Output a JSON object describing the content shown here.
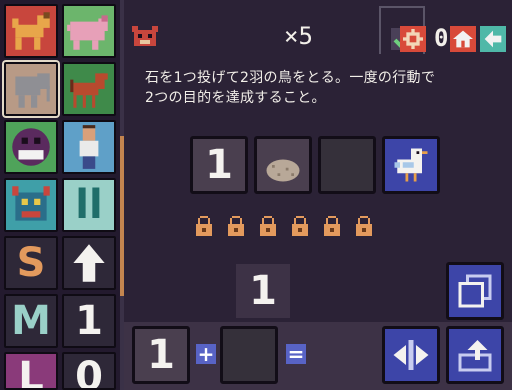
{
  "header": {
    "mascot_icon": "bear-face-icon",
    "count_text": "×5",
    "level_number": "01",
    "settings_icon": "gear-icon",
    "home_icon": "home-icon",
    "back_icon": "back-arrow-icon"
  },
  "instruction": {
    "line1": "石を1つ投げて2羽の鳥をとる。一度の行動で",
    "line2": "2つの目的を達成すること。"
  },
  "puzzle": {
    "slots": [
      {
        "type": "number",
        "value": "1"
      },
      {
        "type": "icon",
        "icon": "stone-icon"
      },
      {
        "type": "empty"
      },
      {
        "type": "icon",
        "icon": "bird-icon"
      }
    ],
    "lock_count": 6
  },
  "equation": {
    "result": "1",
    "left_operand": "1",
    "operator_plus": "+",
    "operator_equals": "=",
    "right_operand": ""
  },
  "sidebar": {
    "tiles": [
      {
        "name": "dog-tile",
        "icon": "dog-icon"
      },
      {
        "name": "pig-tile",
        "icon": "pig-icon"
      },
      {
        "name": "elephant-tile",
        "icon": "elephant-icon"
      },
      {
        "name": "horse-tile",
        "icon": "horse-icon"
      },
      {
        "name": "smiley-tile",
        "icon": "smiley-face-icon"
      },
      {
        "name": "man-tile",
        "icon": "man-icon"
      },
      {
        "name": "monster-tile",
        "icon": "monster-icon"
      },
      {
        "name": "ll-tile",
        "text": "ll"
      },
      {
        "name": "s-tile",
        "text": "S"
      },
      {
        "name": "up-arrow-tile",
        "icon": "up-arrow-icon"
      },
      {
        "name": "m-tile",
        "text": "M"
      },
      {
        "name": "one-tile",
        "text": "1"
      },
      {
        "name": "l-tile",
        "text": "L"
      },
      {
        "name": "zero-tile",
        "text": "0"
      }
    ]
  },
  "actions": {
    "copy_icon": "copy-icon",
    "swap_icon": "swap-arrows-icon",
    "undo_icon": "undo-icon"
  },
  "colors": {
    "background": "#2b2236",
    "accent_blue": "#3d45a8",
    "lock_orange": "#e39a5d"
  }
}
